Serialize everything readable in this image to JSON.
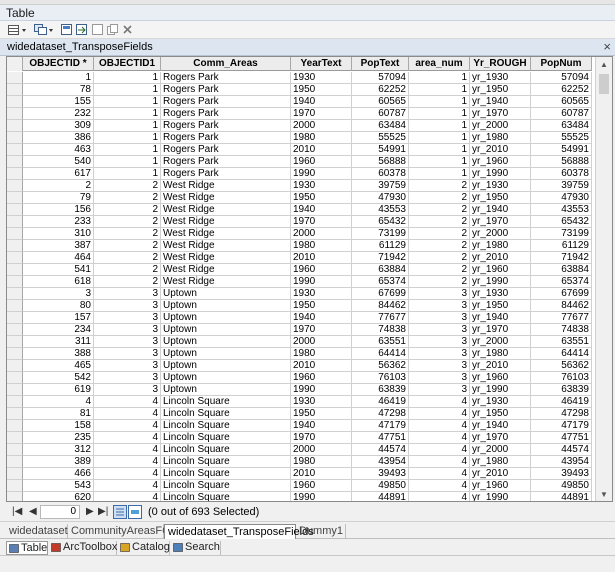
{
  "window_title": "Table",
  "table_name": "widedataset_TransposeFields",
  "columns": [
    "OBJECTID *",
    "OBJECTID1",
    "Comm_Areas",
    "YearText",
    "PopText",
    "area_num",
    "Yr_ROUGH",
    "PopNum"
  ],
  "rows": [
    [
      "1",
      "1",
      "Rogers Park",
      "1930",
      "57094",
      "1",
      "yr_1930",
      "57094"
    ],
    [
      "78",
      "1",
      "Rogers Park",
      "1950",
      "62252",
      "1",
      "yr_1950",
      "62252"
    ],
    [
      "155",
      "1",
      "Rogers Park",
      "1940",
      "60565",
      "1",
      "yr_1940",
      "60565"
    ],
    [
      "232",
      "1",
      "Rogers Park",
      "1970",
      "60787",
      "1",
      "yr_1970",
      "60787"
    ],
    [
      "309",
      "1",
      "Rogers Park",
      "2000",
      "63484",
      "1",
      "yr_2000",
      "63484"
    ],
    [
      "386",
      "1",
      "Rogers Park",
      "1980",
      "55525",
      "1",
      "yr_1980",
      "55525"
    ],
    [
      "463",
      "1",
      "Rogers Park",
      "2010",
      "54991",
      "1",
      "yr_2010",
      "54991"
    ],
    [
      "540",
      "1",
      "Rogers Park",
      "1960",
      "56888",
      "1",
      "yr_1960",
      "56888"
    ],
    [
      "617",
      "1",
      "Rogers Park",
      "1990",
      "60378",
      "1",
      "yr_1990",
      "60378"
    ],
    [
      "2",
      "2",
      "West Ridge",
      "1930",
      "39759",
      "2",
      "yr_1930",
      "39759"
    ],
    [
      "79",
      "2",
      "West Ridge",
      "1950",
      "47930",
      "2",
      "yr_1950",
      "47930"
    ],
    [
      "156",
      "2",
      "West Ridge",
      "1940",
      "43553",
      "2",
      "yr_1940",
      "43553"
    ],
    [
      "233",
      "2",
      "West Ridge",
      "1970",
      "65432",
      "2",
      "yr_1970",
      "65432"
    ],
    [
      "310",
      "2",
      "West Ridge",
      "2000",
      "73199",
      "2",
      "yr_2000",
      "73199"
    ],
    [
      "387",
      "2",
      "West Ridge",
      "1980",
      "61129",
      "2",
      "yr_1980",
      "61129"
    ],
    [
      "464",
      "2",
      "West Ridge",
      "2010",
      "71942",
      "2",
      "yr_2010",
      "71942"
    ],
    [
      "541",
      "2",
      "West Ridge",
      "1960",
      "63884",
      "2",
      "yr_1960",
      "63884"
    ],
    [
      "618",
      "2",
      "West Ridge",
      "1990",
      "65374",
      "2",
      "yr_1990",
      "65374"
    ],
    [
      "3",
      "3",
      "Uptown",
      "1930",
      "67699",
      "3",
      "yr_1930",
      "67699"
    ],
    [
      "80",
      "3",
      "Uptown",
      "1950",
      "84462",
      "3",
      "yr_1950",
      "84462"
    ],
    [
      "157",
      "3",
      "Uptown",
      "1940",
      "77677",
      "3",
      "yr_1940",
      "77677"
    ],
    [
      "234",
      "3",
      "Uptown",
      "1970",
      "74838",
      "3",
      "yr_1970",
      "74838"
    ],
    [
      "311",
      "3",
      "Uptown",
      "2000",
      "63551",
      "3",
      "yr_2000",
      "63551"
    ],
    [
      "388",
      "3",
      "Uptown",
      "1980",
      "64414",
      "3",
      "yr_1980",
      "64414"
    ],
    [
      "465",
      "3",
      "Uptown",
      "2010",
      "56362",
      "3",
      "yr_2010",
      "56362"
    ],
    [
      "542",
      "3",
      "Uptown",
      "1960",
      "76103",
      "3",
      "yr_1960",
      "76103"
    ],
    [
      "619",
      "3",
      "Uptown",
      "1990",
      "63839",
      "3",
      "yr_1990",
      "63839"
    ],
    [
      "4",
      "4",
      "Lincoln Square",
      "1930",
      "46419",
      "4",
      "yr_1930",
      "46419"
    ],
    [
      "81",
      "4",
      "Lincoln Square",
      "1950",
      "47298",
      "4",
      "yr_1950",
      "47298"
    ],
    [
      "158",
      "4",
      "Lincoln Square",
      "1940",
      "47179",
      "4",
      "yr_1940",
      "47179"
    ],
    [
      "235",
      "4",
      "Lincoln Square",
      "1970",
      "47751",
      "4",
      "yr_1970",
      "47751"
    ],
    [
      "312",
      "4",
      "Lincoln Square",
      "2000",
      "44574",
      "4",
      "yr_2000",
      "44574"
    ],
    [
      "389",
      "4",
      "Lincoln Square",
      "1980",
      "43954",
      "4",
      "yr_1980",
      "43954"
    ],
    [
      "466",
      "4",
      "Lincoln Square",
      "2010",
      "39493",
      "4",
      "yr_2010",
      "39493"
    ],
    [
      "543",
      "4",
      "Lincoln Square",
      "1960",
      "49850",
      "4",
      "yr_1960",
      "49850"
    ],
    [
      "620",
      "4",
      "Lincoln Square",
      "1990",
      "44891",
      "4",
      "yr_1990",
      "44891"
    ]
  ],
  "nav": {
    "record_value": "0",
    "status": "(0 out of 693 Selected)"
  },
  "table_tabs": [
    "widedataset",
    "CommunityAreasFC",
    "widedataset_TransposeFields",
    "Dummy1"
  ],
  "active_table_tab": 2,
  "dock_tabs": [
    {
      "label": "Table",
      "icon": "table-icon"
    },
    {
      "label": "ArcToolbox",
      "icon": "toolbox-icon"
    },
    {
      "label": "Catalog",
      "icon": "catalog-icon"
    },
    {
      "label": "Search",
      "icon": "search-icon"
    }
  ]
}
